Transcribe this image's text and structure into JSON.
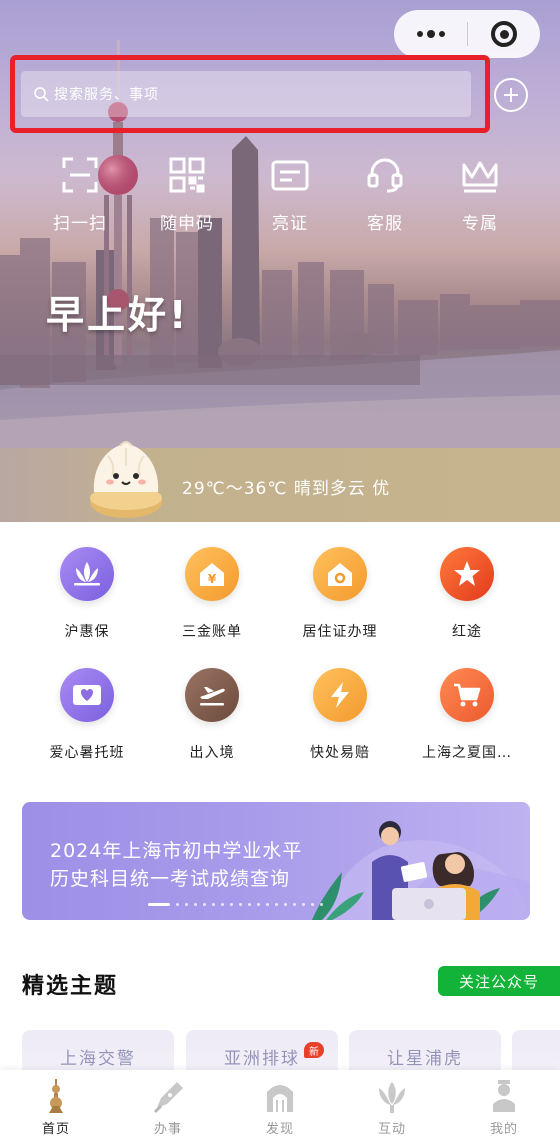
{
  "search": {
    "placeholder": "搜索服务、事项"
  },
  "quick_actions": [
    {
      "label": "扫一扫",
      "icon": "scan-icon"
    },
    {
      "label": "随申码",
      "icon": "qr-code-icon"
    },
    {
      "label": "亮证",
      "icon": "card-icon"
    },
    {
      "label": "客服",
      "icon": "headset-icon"
    },
    {
      "label": "专属",
      "icon": "crown-icon"
    }
  ],
  "greeting": "早上好!",
  "weather": {
    "text": "29℃～36℃ 晴到多云 优"
  },
  "services": [
    {
      "label": "沪惠保",
      "icon": "lotus-icon",
      "color": "#8b6fe0"
    },
    {
      "label": "三金账单",
      "icon": "yuan-house-icon",
      "color": "#f7a53a"
    },
    {
      "label": "居住证办理",
      "icon": "home-icon",
      "color": "#f7a53a"
    },
    {
      "label": "红途",
      "icon": "star-icon",
      "color": "#ee4a26"
    },
    {
      "label": "爱心暑托班",
      "icon": "heart-board-icon",
      "color": "#8b6fe0"
    },
    {
      "label": "出入境",
      "icon": "plane-icon",
      "color": "#7e5a4a"
    },
    {
      "label": "快处易赔",
      "icon": "lightning-icon",
      "color": "#f7a53a"
    },
    {
      "label": "上海之夏国…",
      "icon": "cart-icon",
      "color": "#f06a3c"
    }
  ],
  "banner": {
    "line1": "2024年上海市初中学业水平",
    "line2": "历史科目统一考试成绩查询"
  },
  "section": {
    "title": "精选主题",
    "follow_label": "关注公众号"
  },
  "topic_cards": [
    {
      "label": "上海交警"
    },
    {
      "label": "亚洲排球"
    },
    {
      "label": "让星浦虎"
    }
  ],
  "new_badge": "新",
  "tabs": [
    {
      "label": "首页",
      "icon": "home-tower-icon",
      "active": true
    },
    {
      "label": "办事",
      "icon": "pen-icon",
      "active": false
    },
    {
      "label": "发现",
      "icon": "gate-icon",
      "active": false
    },
    {
      "label": "互动",
      "icon": "flower-icon",
      "active": false
    },
    {
      "label": "我的",
      "icon": "person-icon",
      "active": false
    }
  ]
}
